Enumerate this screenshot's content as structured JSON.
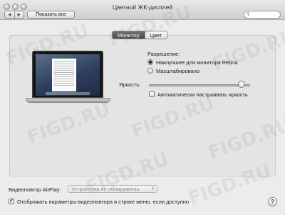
{
  "window": {
    "title": "Цветной ЖК-дисплей"
  },
  "toolbar": {
    "back_icon": "chevron-left-icon",
    "forward_icon": "chevron-right-icon",
    "back_glyph": "◀",
    "forward_glyph": "▶",
    "show_all_label": "Показать все",
    "search_icon": "search-icon",
    "search_glyph": "⚲",
    "search_value": ""
  },
  "tabs": [
    {
      "label": "Монитор",
      "selected": true
    },
    {
      "label": "Цвет",
      "selected": false
    }
  ],
  "display": {
    "resolution_label": "Разрешение:",
    "resolution_options": [
      {
        "label": "Наилучшее для монитора Retina",
        "selected": true
      },
      {
        "label": "Масштабировано",
        "selected": false
      }
    ],
    "brightness_label": "Яркость:",
    "brightness_level": 0.95,
    "auto_brightness_label": "Автоматически настраивать яркость",
    "auto_brightness_checked": false
  },
  "airplay": {
    "label": "Видеоповтор AirPlay:",
    "selected_value": "Устройства не обнаружены",
    "popup_glyph": "⇕"
  },
  "menu_bar_option": {
    "label": "Отображать параметры видеоповтора в строке меню, если доступно",
    "checked": true,
    "check_glyph": "✓"
  },
  "help_button": {
    "label": "?"
  },
  "watermark": {
    "text": "FIGD.RU"
  }
}
